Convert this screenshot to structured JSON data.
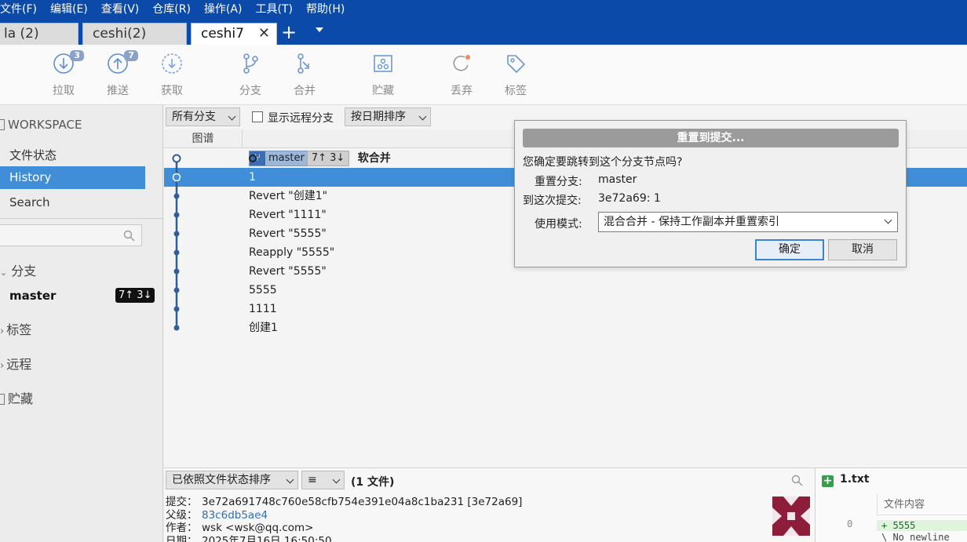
{
  "menu": [
    "文件(F)",
    "编辑(E)",
    "查看(V)",
    "仓库(R)",
    "操作(A)",
    "工具(T)",
    "帮助(H)"
  ],
  "tabs": [
    {
      "label": "la (2)"
    },
    {
      "label": "ceshi(2)"
    },
    {
      "label": "ceshi7",
      "active": true
    }
  ],
  "tab_add": "+",
  "tab_close": "✕",
  "toolbar": {
    "pull": {
      "label": "拉取",
      "badge": "3"
    },
    "push": {
      "label": "推送",
      "badge": "7"
    },
    "fetch": {
      "label": "获取"
    },
    "branch": {
      "label": "分支"
    },
    "merge": {
      "label": "合并"
    },
    "stash": {
      "label": "贮藏"
    },
    "discard": {
      "label": "丢弃"
    },
    "tag": {
      "label": "标签"
    }
  },
  "sidebar": {
    "workspace": "WORKSPACE",
    "file_status": "文件状态",
    "history": "History",
    "search": "Search",
    "branches": "分支",
    "master": "master",
    "master_badge": "7↑ 3↓",
    "tags": "标签",
    "remotes": "远程",
    "stashes": "贮藏"
  },
  "filter": {
    "branches": "所有分支",
    "show_remote": "显示远程分支",
    "sort": "按日期排序"
  },
  "graph_header": "图谱",
  "commits": [
    {
      "msg": "软合并",
      "branch": "master",
      "ahead": "7↑ 3↓"
    },
    {
      "msg": "1",
      "selected": true
    },
    {
      "msg": "Revert \"创建1\""
    },
    {
      "msg": "Revert \"1111\""
    },
    {
      "msg": "Revert \"5555\""
    },
    {
      "msg": "Reapply \"5555\""
    },
    {
      "msg": "Revert \"5555\""
    },
    {
      "msg": "5555"
    },
    {
      "msg": "1111"
    },
    {
      "msg": "创建1"
    }
  ],
  "bottom": {
    "sort": "已依照文件状态排序",
    "view": "≡",
    "files_count": "(1 文件)",
    "commit_label": "提交：",
    "commit": "3e72a691748c760e58cfb754e391e04a8c1ba231 [3e72a69]",
    "parent_label": "父级：",
    "parent": "83c6db5ae4",
    "author_label": "作者：",
    "author": "wsk <wsk@qq.com>",
    "date_label": "日期：",
    "date": "2025年7月16日 16:50:50"
  },
  "diff": {
    "file": "1.txt",
    "header": "文件内容",
    "line_no": "0",
    "added": "+ 5555",
    "no_newline": "\\ No newline"
  },
  "dialog": {
    "title": "重置到提交...",
    "question": "您确定要跳转到这个分支节点吗?",
    "branch_label": "重置分支:",
    "branch_value": "master",
    "commit_label": "到这次提交:",
    "commit_value": "3e72a69: 1",
    "mode_label": "使用模式:",
    "mode_value": "混合合并 - 保持工作副本并重置索引",
    "ok": "确定",
    "cancel": "取消"
  },
  "colors": {
    "accent": "#0b4aa8",
    "selection": "#3f8ed7",
    "graph": "#2f5f96"
  }
}
